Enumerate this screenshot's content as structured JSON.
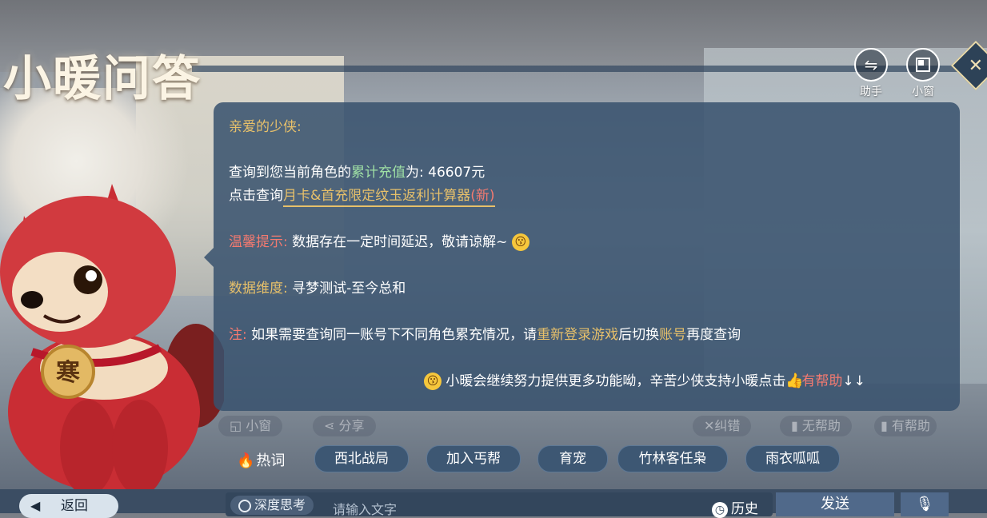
{
  "app": {
    "title": "小暖问答"
  },
  "top_buttons": {
    "assistant": {
      "label": "助手",
      "icon": "swap-arrows-icon"
    },
    "mini_window": {
      "label": "小窗",
      "icon": "mini-window-icon"
    },
    "close": {
      "icon": "close-icon"
    }
  },
  "message": {
    "greeting": "亲爱的少侠:",
    "query_prefix": "查询到您当前角色的",
    "query_highlight": "累计充值",
    "query_suffix": "为: 46607元",
    "link_prefix": "点击查询",
    "link_text": "月卡&首充限定纹玉返利计算器",
    "link_new": "(新)",
    "tip_label": "温馨提示:",
    "tip_text": "数据存在一定时间延迟，敬请谅解~",
    "dimension_label": "数据维度:",
    "dimension_text": "寻梦测试-至今总和",
    "note_label": "注:",
    "note_text_1": "如果需要查询同一账号下不同角色累充情况，请",
    "note_highlight_1": "重新登录游戏",
    "note_text_2": "后切换",
    "note_highlight_2": "账号",
    "note_text_3": "再度查询",
    "footer_text": "小暖会继续努力提供更多功能呦，辛苦少侠支持小暖点击",
    "footer_helpful": "有帮助",
    "footer_arrows": "↓↓"
  },
  "feedback": {
    "mini": "小窗",
    "share": "分享",
    "correct": "纠错",
    "unhelpful": "无帮助",
    "helpful": "有帮助"
  },
  "hot_words": {
    "label": "热词",
    "items": [
      "西北战局",
      "加入丐帮",
      "育宠",
      "竹林客任枭",
      "雨衣呱呱"
    ]
  },
  "bottom": {
    "back": "返回",
    "deep_think": "深度思考",
    "input_placeholder": "请输入文字",
    "history": "历史",
    "send": "发送"
  },
  "mascot": {
    "badge_text": "寒"
  },
  "colors": {
    "accent_gold": "#e7c06a",
    "accent_green": "#9fe0a5",
    "accent_red": "#f47a70",
    "bubble": "#38516e"
  }
}
